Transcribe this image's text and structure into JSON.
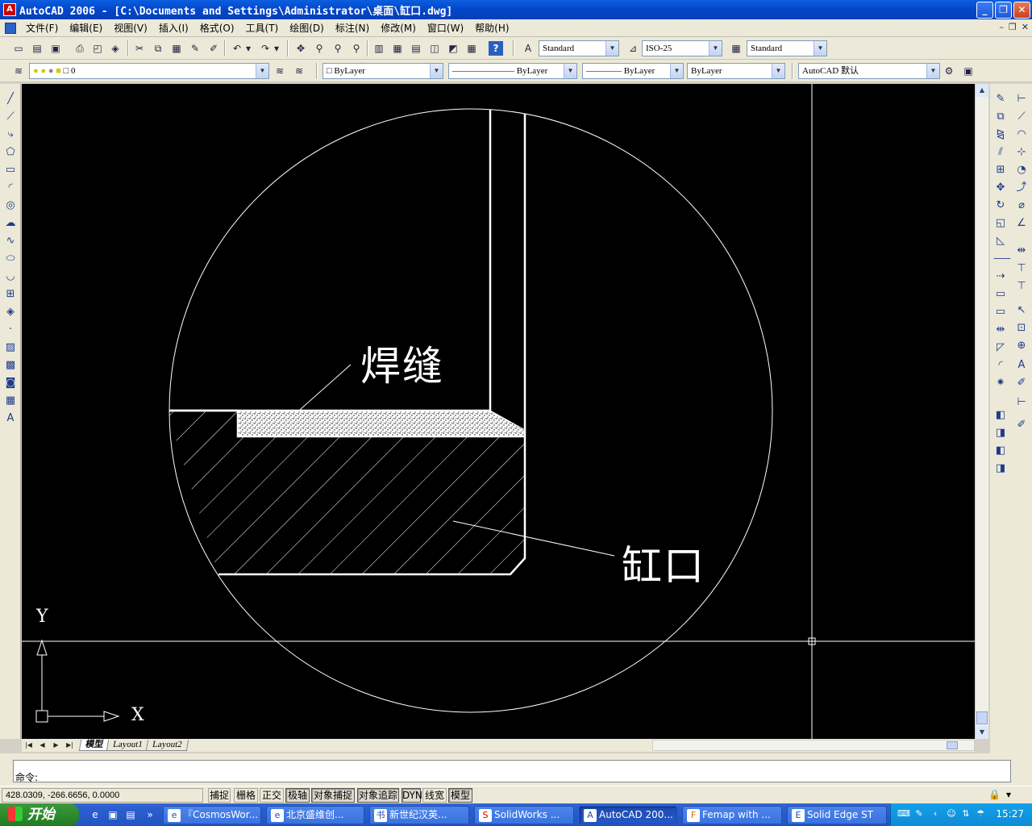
{
  "window": {
    "title": "AutoCAD 2006 - [C:\\Documents and Settings\\Administrator\\桌面\\缸口.dwg]",
    "app_icon": "A"
  },
  "menus": [
    "文件(F)",
    "编辑(E)",
    "视图(V)",
    "插入(I)",
    "格式(O)",
    "工具(T)",
    "绘图(D)",
    "标注(N)",
    "修改(M)",
    "窗口(W)",
    "帮助(H)"
  ],
  "toolbar1": {
    "text_style": "Standard",
    "dim_style": "ISO-25",
    "table_style": "Standard"
  },
  "toolbar2": {
    "layer": "0",
    "color": "ByLayer",
    "linetype": "ByLayer",
    "lineweight": "ByLayer",
    "plotstyle": "ByLayer",
    "workspace": "AutoCAD 默认"
  },
  "drawing": {
    "weld_label": "焊缝",
    "bore_label": "缸口",
    "ucs_x": "X",
    "ucs_y": "Y"
  },
  "layout_tabs": [
    "模型",
    "Layout1",
    "Layout2"
  ],
  "command": {
    "prompt": "命令:"
  },
  "status": {
    "coords": "428.0309, -266.6656, 0.0000",
    "toggles": [
      {
        "label": "捕捉",
        "on": false
      },
      {
        "label": "栅格",
        "on": false
      },
      {
        "label": "正交",
        "on": false
      },
      {
        "label": "极轴",
        "on": true
      },
      {
        "label": "对象捕捉",
        "on": true
      },
      {
        "label": "对象追踪",
        "on": true
      },
      {
        "label": "DYN",
        "on": true
      },
      {
        "label": "线宽",
        "on": false
      },
      {
        "label": "模型",
        "on": true
      }
    ]
  },
  "taskbar": {
    "start": "开始",
    "tasks": [
      {
        "label": "『CosmosWor...",
        "icon": "e",
        "active": false
      },
      {
        "label": "北京盛维创...",
        "icon": "e",
        "active": false
      },
      {
        "label": "新世纪汉英...",
        "icon": "书",
        "active": false
      },
      {
        "label": "SolidWorks ...",
        "icon": "S",
        "active": false
      },
      {
        "label": "AutoCAD 200...",
        "icon": "A",
        "active": true
      },
      {
        "label": "Femap with ...",
        "icon": "F",
        "active": false
      },
      {
        "label": "Solid Edge ST",
        "icon": "E",
        "active": false
      }
    ],
    "clock": "15:27"
  }
}
